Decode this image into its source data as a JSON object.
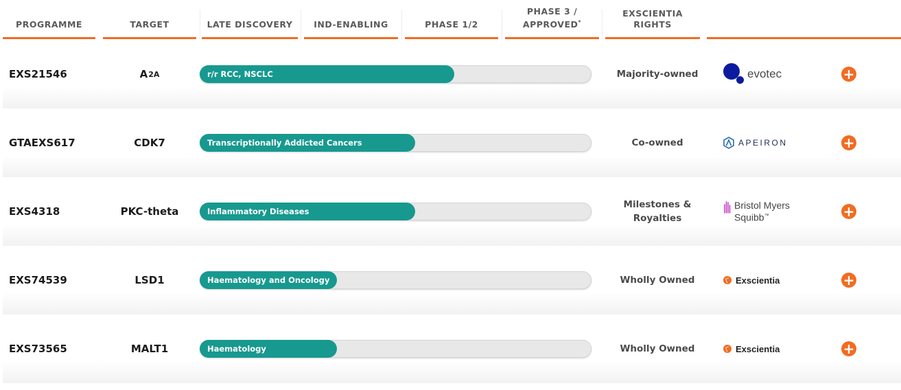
{
  "header": {
    "programme": "PROGRAMME",
    "target": "TARGET",
    "late_discovery": "LATE DISCOVERY",
    "ind_enabling": "IND-ENABLING",
    "phase12": "PHASE 1/2",
    "phase3_line1": "PHASE 3 /",
    "phase3_line2": "APPROVED",
    "phase3_sup": "*",
    "rights_line1": "EXSCIENTIA",
    "rights_line2": "RIGHTS"
  },
  "rows": [
    {
      "programme": "EXS21546",
      "target": "A",
      "target_sub": "2A",
      "indication": "r/r RCC, NSCLC",
      "progress": 0.65,
      "rights": "Majority-owned",
      "partner_logo": "evotec-logo",
      "partner_text": "evotec",
      "expand_icon": "plus-circle-icon"
    },
    {
      "programme": "GTAEXS617",
      "target": "CDK7",
      "target_sub": "",
      "indication": "Transcriptionally Addicted Cancers",
      "progress": 0.55,
      "rights": "Co-owned",
      "partner_logo": "apeiron-logo",
      "partner_text": "APEIRON",
      "expand_icon": "plus-circle-icon"
    },
    {
      "programme": "EXS4318",
      "target": "PKC-theta",
      "target_sub": "",
      "indication": "Inflammatory Diseases",
      "progress": 0.55,
      "rights_line1": "Milestones &",
      "rights_line2": "Royalties",
      "partner_logo": "bristol-myers-squibb-logo",
      "partner_line1": "Bristol Myers",
      "partner_line2": "Squibb",
      "partner_tm": "™",
      "expand_icon": "plus-circle-icon"
    },
    {
      "programme": "EXS74539",
      "target": "LSD1",
      "target_sub": "",
      "indication": "Haematology and Oncology",
      "progress": 0.35,
      "rights": "Wholly Owned",
      "partner_logo": "exscientia-logo",
      "partner_text": "Exscientia",
      "expand_icon": "plus-circle-icon"
    },
    {
      "programme": "EXS73565",
      "target": "MALT1",
      "target_sub": "",
      "indication": "Haematology",
      "progress": 0.35,
      "rights": "Wholly Owned",
      "partner_logo": "exscientia-logo",
      "partner_text": "Exscientia",
      "expand_icon": "plus-circle-icon"
    }
  ],
  "colors": {
    "accent_orange": "#f26c21",
    "bar_teal": "#17998f",
    "track_grey": "#e8e8e8",
    "evotec_blue": "#0c1b9e",
    "bms_purple": "#be2bbb"
  }
}
